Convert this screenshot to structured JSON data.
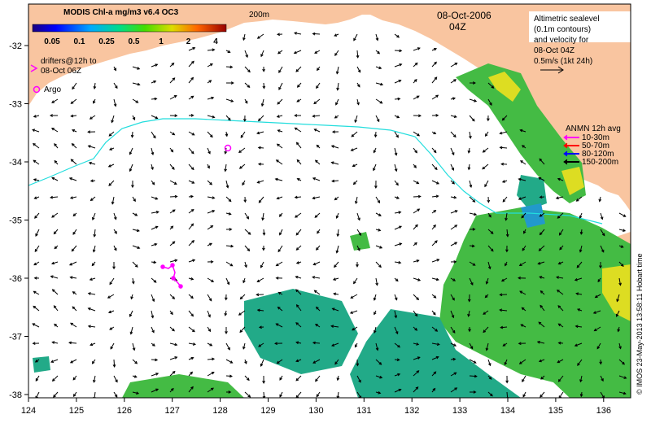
{
  "colorbar": {
    "title": "MODIS Chl-a mg/m3 v6.4 OC3",
    "ticks": [
      "0.05",
      "0.1",
      "0.25",
      "0.5",
      "1",
      "2",
      "4"
    ]
  },
  "isobath_label": "200m",
  "date": "08-Oct-2006",
  "time": "04Z",
  "altimetry_note": {
    "lines": [
      "Altimetric sealevel",
      "(0.1m contours)",
      "and velocity for",
      "08-Oct 04Z",
      "0.5m/s (1kt 24h)"
    ]
  },
  "drifters_legend": {
    "line1": "drifters@12h to",
    "line2": "08-Oct 06Z",
    "argo": "Argo"
  },
  "anmn_legend": {
    "title": "ANMN 12h avg",
    "items": [
      {
        "label": "10-30m",
        "color": "#ff00ff"
      },
      {
        "label": "50-70m",
        "color": "#ff0000"
      },
      {
        "label": "80-120m",
        "color": "#0000ff"
      },
      {
        "label": "150-200m",
        "color": "#000000"
      }
    ]
  },
  "lon_ticks": [
    "124",
    "125",
    "126",
    "127",
    "128",
    "129",
    "130",
    "131",
    "132",
    "133",
    "134",
    "135",
    "136"
  ],
  "lat_ticks": [
    "-32",
    "-33",
    "-34",
    "-35",
    "-36",
    "-37",
    "-38"
  ],
  "credit": "© IMOS 23-May-2013 13:58:11 Hobart time",
  "colors": {
    "land": "#f9c5a0",
    "isobath": "#22dddd",
    "drifter": "#ff00ff",
    "chl_green": "#44bb44",
    "chl_teal": "#22aa88",
    "chl_yellow": "#dddd22"
  }
}
